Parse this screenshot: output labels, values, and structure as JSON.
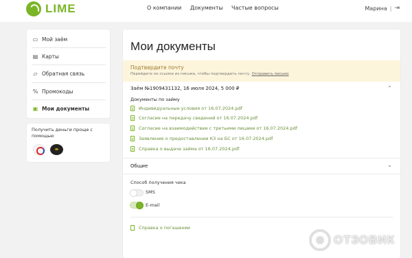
{
  "header": {
    "logo_text": "LIME",
    "nav": [
      "О компании",
      "Документы",
      "Частые вопросы"
    ],
    "user_name": "Марина",
    "separator": "|",
    "logout_glyph": "⇥"
  },
  "sidebar": {
    "items": [
      {
        "label": "Мой заём",
        "icon": "loan-icon",
        "glyph": "▭"
      },
      {
        "label": "Карты",
        "icon": "card-icon",
        "glyph": "▤"
      },
      {
        "label": "Обратная связь",
        "icon": "chat-icon",
        "glyph": "▱"
      },
      {
        "label": "Промокоды",
        "icon": "percent-icon",
        "glyph": "%"
      },
      {
        "label": "Мои документы",
        "icon": "documents-icon",
        "glyph": "▣"
      }
    ]
  },
  "promo": {
    "title": "Получить деньги проще с помощью",
    "badge_text": "ю"
  },
  "main": {
    "title": "Мои документы",
    "banner": {
      "title": "Подтвердите почту",
      "text": "Перейдите по ссылке из письма, чтобы подтвердить почту.",
      "link": "Отправить письмо"
    },
    "loan_title": "Заём №1909431132, 16 июля 2024, 5 000 ₽",
    "chevron_up": "⌃",
    "chevron_down": "⌄",
    "docs_label": "Документы по займу",
    "docs": [
      "Индивидуальные условия от 16.07.2024.pdf",
      "Согласие на передачу сведений от 16.07.2024.pdf",
      "Согласие на взаимодействие с третьими лицами от 16.07.2024.pdf",
      "Заявление о предоставлении КЗ на БС от 16.07.2024.pdf",
      "Справка о выдаче займа от 16.07.2024.pdf"
    ],
    "general_label": "Общие",
    "receipt_label": "Способ получения чека",
    "receipt_options": [
      {
        "label": "SMS",
        "on": false
      },
      {
        "label": "E-mail",
        "on": true
      }
    ],
    "repayment_doc": "Справка о погашении"
  },
  "watermark": "ОТЗОВИК",
  "colors": {
    "accent": "#7ab526",
    "banner_bg": "#fdf4dc",
    "banner_title": "#9c7a2a",
    "link": "#6a8f3a"
  }
}
